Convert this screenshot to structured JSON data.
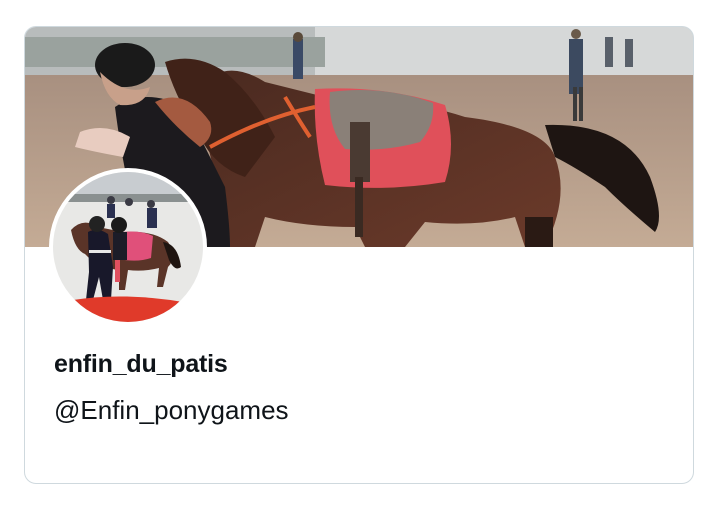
{
  "profile": {
    "display_name": "enfin_du_patis",
    "handle": "@Enfin_ponygames"
  },
  "colors": {
    "card_border": "#cfd9de",
    "text_primary": "#0f1419",
    "saddle_pad": "#e0505a",
    "arena_sand": "#b49a82",
    "horse_bay": "#5a3024"
  },
  "images": {
    "banner": "banner-photo",
    "avatar": "avatar-photo"
  }
}
